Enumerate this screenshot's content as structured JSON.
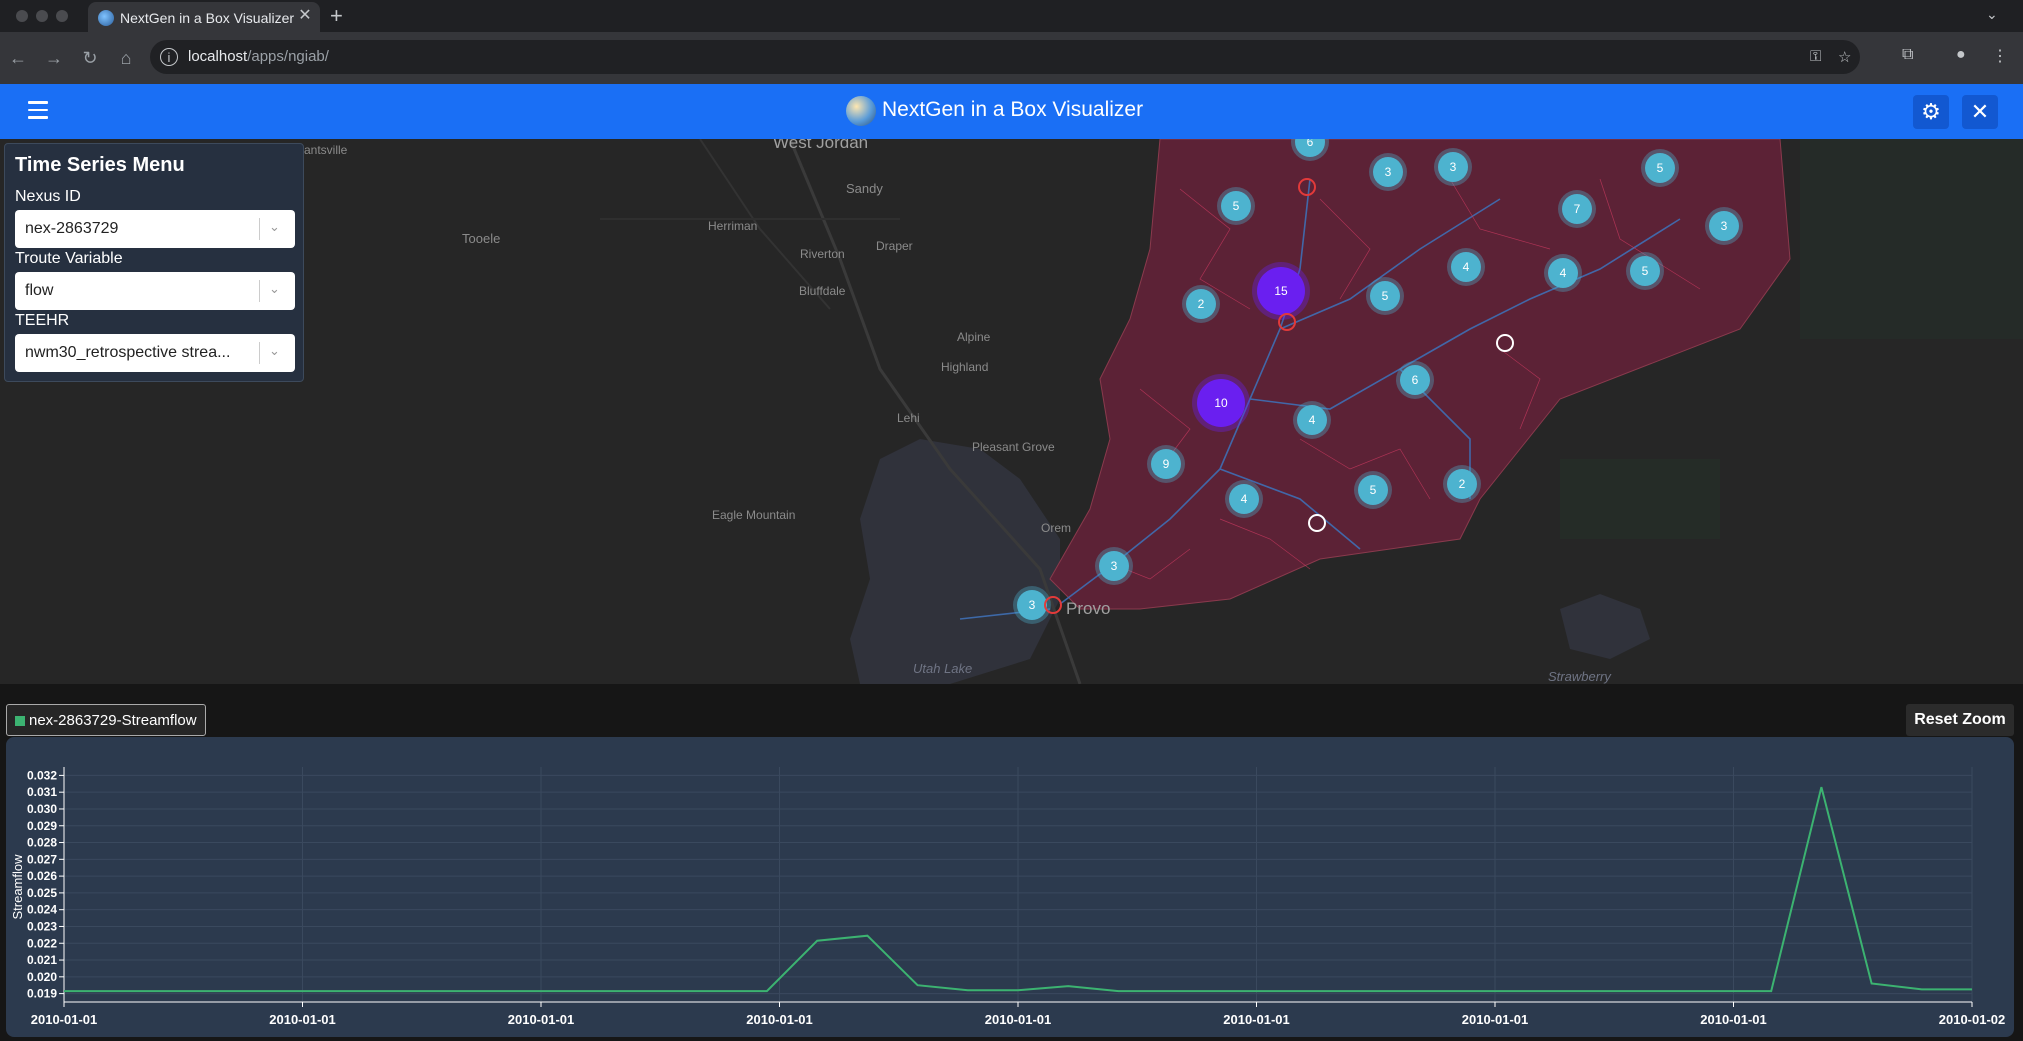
{
  "browser": {
    "tab_title": "NextGen in a Box Visualizer",
    "tab_favicon": "globe-icon",
    "url_host": "localhost",
    "url_path": "/apps/ngiab/"
  },
  "header": {
    "title": "NextGen in a Box Visualizer",
    "menu_icon": "hamburger-icon",
    "settings_icon": "gear-icon",
    "close_icon": "close-icon"
  },
  "map": {
    "places": [
      "West Jordan",
      "Sandy",
      "Tooele",
      "Herriman",
      "Riverton",
      "Draper",
      "Bluffdale",
      "Alpine",
      "Highland",
      "Lehi",
      "Pleasant Grove",
      "Eagle Mountain",
      "Orem",
      "Provo",
      "Utah Lake",
      "Strawberry",
      "rantsville"
    ],
    "clusters": [
      6,
      3,
      3,
      5,
      5,
      7,
      3,
      4,
      15,
      5,
      4,
      5,
      2,
      6,
      10,
      4,
      9,
      4,
      5,
      2,
      3,
      3
    ]
  },
  "time_series_menu": {
    "title": "Time Series Menu",
    "nexus_label": "Nexus ID",
    "nexus_value": "nex-2863729",
    "troute_label": "Troute Variable",
    "troute_value": "flow",
    "teehr_label": "TEEHR",
    "teehr_value": "nwm30_retrospective strea..."
  },
  "chart_controls": {
    "legend_label": "nex-2863729-Streamflow",
    "reset_label": "Reset Zoom"
  },
  "colors": {
    "accent": "#1a6ff5",
    "series": "#3cb371",
    "cluster_small": "#4db3cf",
    "cluster_large": "#6a1ff0",
    "catchment": "#6b2136"
  },
  "chart_data": {
    "type": "line",
    "ylabel": "Streamflow",
    "xlabel": "",
    "ylim": [
      0.0185,
      0.0325
    ],
    "yticks": [
      "0.032",
      "0.031",
      "0.030",
      "0.029",
      "0.028",
      "0.027",
      "0.026",
      "0.025",
      "0.024",
      "0.023",
      "0.022",
      "0.021",
      "0.020",
      "0.019"
    ],
    "xticks": [
      "2010-01-01",
      "2010-01-01",
      "2010-01-01",
      "2010-01-01",
      "2010-01-01",
      "2010-01-01",
      "2010-01-01",
      "2010-01-01",
      "2010-01-02"
    ],
    "series": [
      {
        "name": "nex-2863729-Streamflow",
        "values": [
          0.01915,
          0.01915,
          0.01915,
          0.01915,
          0.01915,
          0.01915,
          0.01915,
          0.01915,
          0.01915,
          0.01915,
          0.01915,
          0.01915,
          0.01915,
          0.01915,
          0.01915,
          0.02215,
          0.02245,
          0.0195,
          0.0192,
          0.0192,
          0.01945,
          0.01915,
          0.01915,
          0.01915,
          0.01915,
          0.01915,
          0.01915,
          0.01915,
          0.01915,
          0.01915,
          0.01915,
          0.01915,
          0.01915,
          0.01915,
          0.01915,
          0.0313,
          0.0196,
          0.01925,
          0.01925
        ]
      }
    ]
  }
}
